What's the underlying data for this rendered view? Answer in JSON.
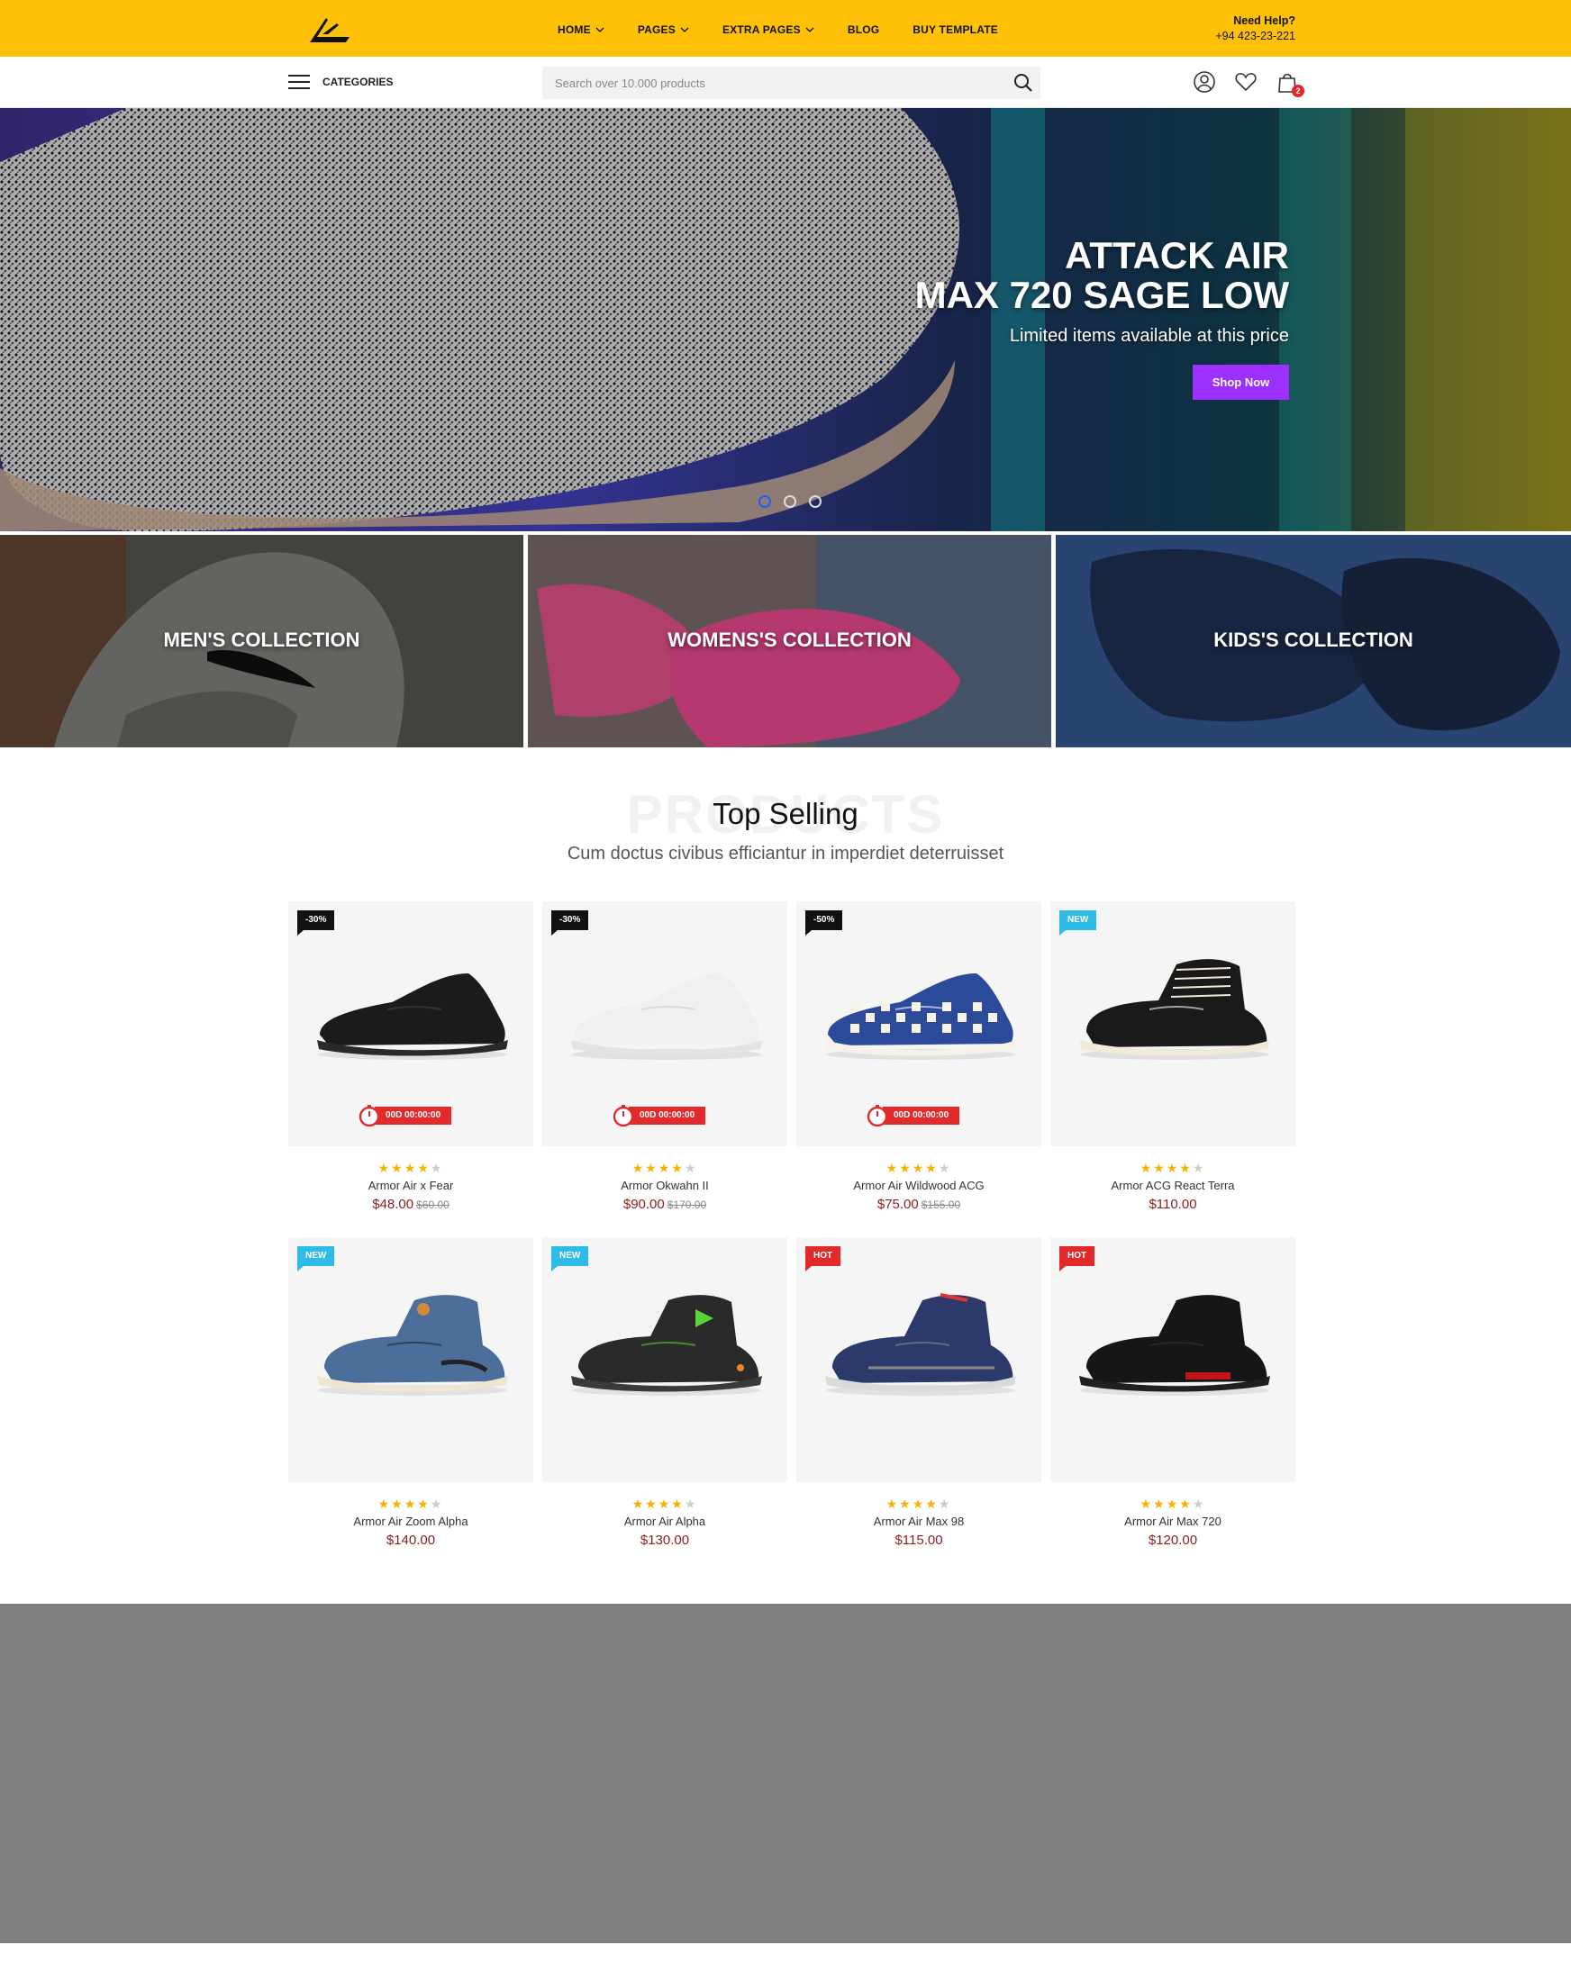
{
  "header": {
    "nav": [
      {
        "label": "HOME",
        "has_dropdown": true
      },
      {
        "label": "PAGES",
        "has_dropdown": true
      },
      {
        "label": "EXTRA PAGES",
        "has_dropdown": true
      },
      {
        "label": "BLOG",
        "has_dropdown": false
      },
      {
        "label": "BUY TEMPLATE",
        "has_dropdown": false
      }
    ],
    "help_title": "Need Help?",
    "help_phone": "+94 423-23-221",
    "accent": "#ffc107"
  },
  "toolbar": {
    "categories_label": "CATEGORIES",
    "search_placeholder": "Search over 10.000 products",
    "cart_count": "2"
  },
  "hero": {
    "title_line1": "ATTACK AIR",
    "title_line2": "MAX 720 SAGE LOW",
    "subtitle": "Limited items available at this price",
    "button": "Shop Now",
    "button_color": "#9b30ff",
    "active_slide": 1,
    "slides": 3
  },
  "collections": [
    {
      "label": "MEN'S COLLECTION"
    },
    {
      "label": "WOMENS'S COLLECTION"
    },
    {
      "label": "KIDS'S COLLECTION"
    }
  ],
  "section": {
    "bg_word": "PRODUCTS",
    "title": "Top Selling",
    "subtitle": "Cum doctus civibus efficiantur in imperdiet deterruisset"
  },
  "products": [
    {
      "tag": "-30%",
      "tag_style": "dark",
      "timer": "00D 00:00:00",
      "rating": 4,
      "name": "Armor Air x Fear",
      "price": "$48.00",
      "old_price": "$60.00",
      "shoe": "black-runner"
    },
    {
      "tag": "-30%",
      "tag_style": "dark",
      "timer": "00D 00:00:00",
      "rating": 4,
      "name": "Armor Okwahn II",
      "price": "$90.00",
      "old_price": "$170.00",
      "shoe": "white-runner"
    },
    {
      "tag": "-50%",
      "tag_style": "dark",
      "timer": "00D 00:00:00",
      "rating": 4,
      "name": "Armor Air Wildwood ACG",
      "price": "$75.00",
      "old_price": "$155.00",
      "shoe": "checker-slipon"
    },
    {
      "tag": "NEW",
      "tag_style": "blue",
      "timer": "",
      "rating": 4,
      "name": "Armor ACG React Terra",
      "price": "$110.00",
      "old_price": "",
      "shoe": "black-hightop"
    },
    {
      "tag": "NEW",
      "tag_style": "blue",
      "timer": "",
      "rating": 4,
      "name": "Armor Air Zoom Alpha",
      "price": "$140.00",
      "old_price": "",
      "shoe": "denim-jordan"
    },
    {
      "tag": "NEW",
      "tag_style": "blue",
      "timer": "",
      "rating": 4,
      "name": "Armor Air Alpha",
      "price": "$130.00",
      "old_price": "",
      "shoe": "black-green"
    },
    {
      "tag": "HOT",
      "tag_style": "red",
      "timer": "",
      "rating": 4,
      "name": "Armor Air Max 98",
      "price": "$115.00",
      "old_price": "",
      "shoe": "navy-jordan"
    },
    {
      "tag": "HOT",
      "tag_style": "red",
      "timer": "",
      "rating": 4,
      "name": "Armor Air Max 720",
      "price": "$120.00",
      "old_price": "",
      "shoe": "black-red"
    }
  ]
}
